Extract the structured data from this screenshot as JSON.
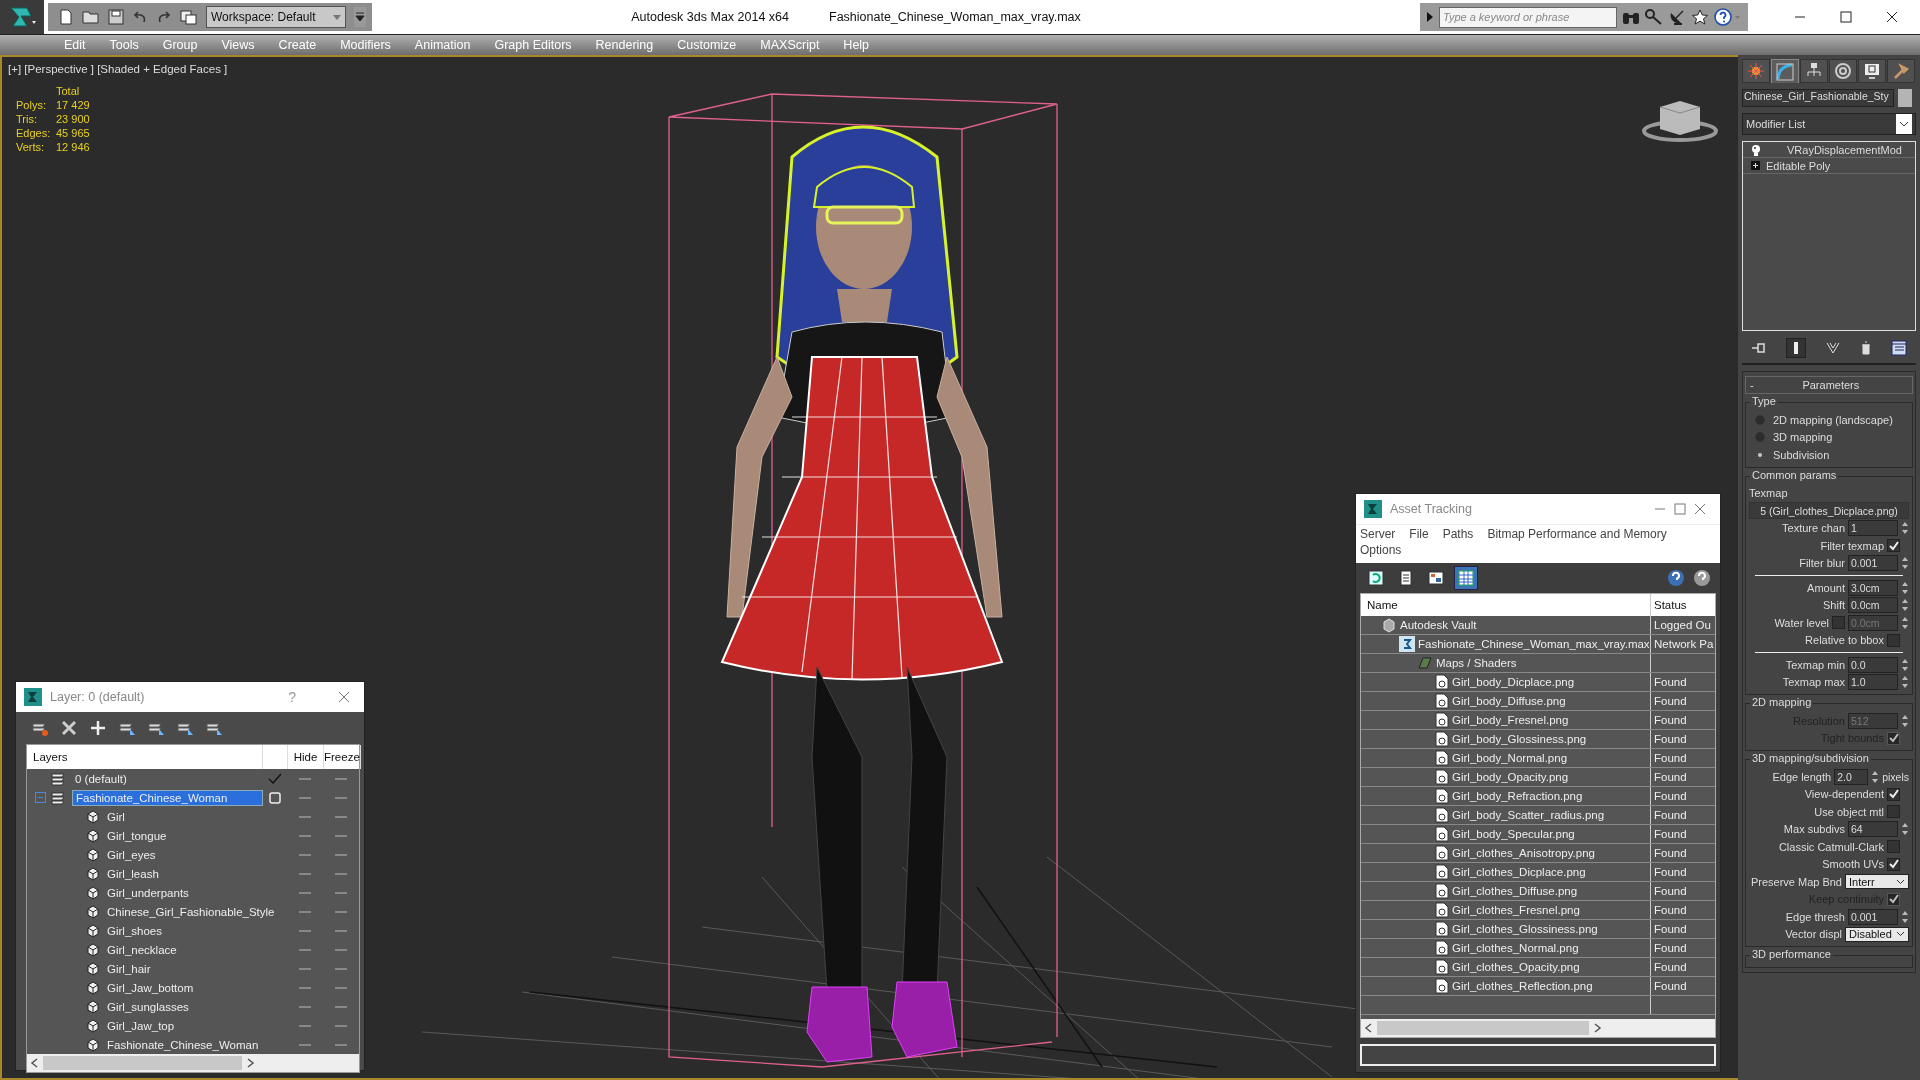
{
  "title_bar": {
    "workspace": "Workspace: Default",
    "app_title": "Autodesk 3ds Max  2014 x64",
    "file_name": "Fashionate_Chinese_Woman_max_vray.max",
    "search": {
      "placeholder": "Type a keyword or phrase"
    }
  },
  "menu": [
    "Edit",
    "Tools",
    "Group",
    "Views",
    "Create",
    "Modifiers",
    "Animation",
    "Graph Editors",
    "Rendering",
    "Customize",
    "MAXScript",
    "Help"
  ],
  "viewport": {
    "label": "[+] [Perspective ] [Shaded + Edged Faces ]",
    "stats": {
      "header": "Total",
      "rows": [
        {
          "label": "Polys:",
          "value": "17 429"
        },
        {
          "label": "Tris:",
          "value": "23 900"
        },
        {
          "label": "Edges:",
          "value": "45 965"
        },
        {
          "label": "Verts:",
          "value": "12 946"
        }
      ]
    }
  },
  "layer_window": {
    "title": "Layer: 0 (default)",
    "help": "?",
    "columns": [
      "Layers",
      "Hide",
      "Freeze"
    ],
    "layers": [
      {
        "name": "0 (default)",
        "current": true,
        "selected": false,
        "hidden": false,
        "frozen": false
      },
      {
        "name": "Fashionate_Chinese_Woman",
        "current": false,
        "selected": true,
        "hidden": false,
        "frozen": false,
        "expanded": true,
        "children": [
          {
            "name": "Girl",
            "hidden": false,
            "frozen": false
          },
          {
            "name": "Girl_tongue",
            "hidden": false,
            "frozen": false
          },
          {
            "name": "Girl_eyes",
            "hidden": false,
            "frozen": false
          },
          {
            "name": "Girl_leash",
            "hidden": false,
            "frozen": false
          },
          {
            "name": "Girl_underpants",
            "hidden": false,
            "frozen": false
          },
          {
            "name": "Chinese_Girl_Fashionable_Style",
            "hidden": false,
            "frozen": false
          },
          {
            "name": "Girl_shoes",
            "hidden": false,
            "frozen": false
          },
          {
            "name": "Girl_necklace",
            "hidden": false,
            "frozen": false
          },
          {
            "name": "Girl_hair",
            "hidden": false,
            "frozen": false
          },
          {
            "name": "Girl_Jaw_bottom",
            "hidden": false,
            "frozen": false
          },
          {
            "name": "Girl_sunglasses",
            "hidden": false,
            "frozen": false
          },
          {
            "name": "Girl_Jaw_top",
            "hidden": false,
            "frozen": false
          },
          {
            "name": "Fashionate_Chinese_Woman",
            "hidden": false,
            "frozen": false
          }
        ]
      }
    ]
  },
  "asset_window": {
    "title": "Asset Tracking",
    "menu": [
      "Server",
      "File",
      "Paths",
      "Bitmap Performance and Memory",
      "Options"
    ],
    "view_buttons": [
      {
        "selected": false
      },
      {
        "selected": false
      },
      {
        "selected": false
      },
      {
        "selected": true
      }
    ],
    "columns": [
      "Name",
      "Status"
    ],
    "rows": [
      {
        "kind": "vault",
        "name": "Autodesk Vault",
        "status": "Logged Ou",
        "children": [
          {
            "kind": "scene",
            "name": "Fashionate_Chinese_Woman_max_vray.max",
            "status": "Network Pa",
            "children": [
              {
                "kind": "folder",
                "name": "Maps / Shaders",
                "children": [
                  {
                    "kind": "bitmap",
                    "name": "Girl_body_Dicplace.png",
                    "status": "Found"
                  },
                  {
                    "kind": "bitmap",
                    "name": "Girl_body_Diffuse.png",
                    "status": "Found"
                  },
                  {
                    "kind": "bitmap",
                    "name": "Girl_body_Fresnel.png",
                    "status": "Found"
                  },
                  {
                    "kind": "bitmap",
                    "name": "Girl_body_Glossiness.png",
                    "status": "Found"
                  },
                  {
                    "kind": "bitmap",
                    "name": "Girl_body_Normal.png",
                    "status": "Found"
                  },
                  {
                    "kind": "bitmap",
                    "name": "Girl_body_Opacity.png",
                    "status": "Found"
                  },
                  {
                    "kind": "bitmap",
                    "name": "Girl_body_Refraction.png",
                    "status": "Found"
                  },
                  {
                    "kind": "bitmap",
                    "name": "Girl_body_Scatter_radius.png",
                    "status": "Found"
                  },
                  {
                    "kind": "bitmap",
                    "name": "Girl_body_Specular.png",
                    "status": "Found"
                  },
                  {
                    "kind": "bitmap",
                    "name": "Girl_clothes_Anisotropy.png",
                    "status": "Found"
                  },
                  {
                    "kind": "bitmap",
                    "name": "Girl_clothes_Dicplace.png",
                    "status": "Found"
                  },
                  {
                    "kind": "bitmap",
                    "name": "Girl_clothes_Diffuse.png",
                    "status": "Found"
                  },
                  {
                    "kind": "bitmap",
                    "name": "Girl_clothes_Fresnel.png",
                    "status": "Found"
                  },
                  {
                    "kind": "bitmap",
                    "name": "Girl_clothes_Glossiness.png",
                    "status": "Found"
                  },
                  {
                    "kind": "bitmap",
                    "name": "Girl_clothes_Normal.png",
                    "status": "Found"
                  },
                  {
                    "kind": "bitmap",
                    "name": "Girl_clothes_Opacity.png",
                    "status": "Found"
                  },
                  {
                    "kind": "bitmap",
                    "name": "Girl_clothes_Reflection.png",
                    "status": "Found"
                  }
                ]
              }
            ]
          }
        ]
      }
    ]
  },
  "command_panel": {
    "tabs": [
      {
        "selected": false
      },
      {
        "selected": true
      },
      {
        "selected": false
      },
      {
        "selected": false
      },
      {
        "selected": false
      },
      {
        "selected": false
      }
    ],
    "object_name": "Chinese_Girl_Fashionable_Sty",
    "modifier_list": "Modifier List",
    "stack": [
      {
        "kind": "modifier",
        "name": "VRayDisplacementMod"
      },
      {
        "kind": "base",
        "name": "Editable Poly"
      }
    ],
    "rollout": {
      "toggle": "-",
      "title": "Parameters",
      "groups": [
        {
          "title": "Type",
          "rows": [
            {
              "kind": "radio",
              "label": "2D mapping (landscape)",
              "selected": false
            },
            {
              "kind": "radio",
              "label": "3D mapping",
              "selected": false
            },
            {
              "kind": "radio",
              "label": "Subdivision",
              "selected": true
            }
          ]
        },
        {
          "title": "Common params",
          "rows": [
            {
              "kind": "label",
              "label": "Texmap"
            },
            {
              "kind": "map_button",
              "label": "5 (Girl_clothes_Dicplace.png)"
            },
            {
              "kind": "spinner",
              "label": "Texture chan",
              "value": "1",
              "disabled": false
            },
            {
              "kind": "check",
              "label": "Filter texmap",
              "checked": true,
              "disabled": false
            },
            {
              "kind": "spinner",
              "label": "Filter blur",
              "value": "0.001",
              "disabled": false
            },
            {
              "kind": "rule"
            },
            {
              "kind": "spinner",
              "label": "Amount",
              "value": "3.0cm",
              "disabled": false
            },
            {
              "kind": "spinner",
              "label": "Shift",
              "value": "0.0cm",
              "disabled": false
            },
            {
              "kind": "check_spinner",
              "label": "Water level",
              "checked": false,
              "value": "0.0cm"
            },
            {
              "kind": "check",
              "label": "Relative to bbox",
              "checked": false,
              "disabled": false
            },
            {
              "kind": "rule"
            },
            {
              "kind": "spinner",
              "label": "Texmap min",
              "value": "0.0",
              "disabled": false
            },
            {
              "kind": "spinner",
              "label": "Texmap max",
              "value": "1.0",
              "disabled": false
            }
          ]
        },
        {
          "title": "2D mapping",
          "rows": [
            {
              "kind": "spinner",
              "label": "Resolution",
              "value": "512",
              "disabled": true
            },
            {
              "kind": "check",
              "label": "Tight bounds",
              "checked": true,
              "disabled": true
            }
          ]
        },
        {
          "title": "3D mapping/subdivision",
          "rows": [
            {
              "kind": "spinner_unit",
              "label": "Edge length",
              "value": "2.0",
              "unit": "pixels"
            },
            {
              "kind": "check",
              "label": "View-dependent",
              "checked": true,
              "disabled": false
            },
            {
              "kind": "check",
              "label": "Use object mtl",
              "checked": false,
              "disabled": false
            },
            {
              "kind": "spinner",
              "label": "Max subdivs",
              "value": "64",
              "disabled": false
            },
            {
              "kind": "check",
              "label": "Classic Catmull-Clark",
              "checked": false,
              "disabled": false
            },
            {
              "kind": "check",
              "label": "Smooth UVs",
              "checked": true,
              "disabled": false
            },
            {
              "kind": "dropdown",
              "label": "Preserve Map Bnd",
              "value": "Interr"
            },
            {
              "kind": "check",
              "label": "Keep continuity",
              "checked": true,
              "disabled": true
            },
            {
              "kind": "spinner",
              "label": "Edge thresh",
              "value": "0.001",
              "disabled": false
            },
            {
              "kind": "dropdown",
              "label": "Vector displ",
              "value": "Disabled"
            }
          ]
        },
        {
          "title": "3D performance"
        }
      ]
    }
  }
}
